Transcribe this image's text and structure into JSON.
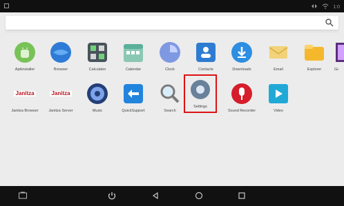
{
  "status_bar": {
    "left_icon": "notification-icon",
    "right_icons": [
      "network-icon",
      "wifi-icon"
    ],
    "clock": "1:0"
  },
  "search": {
    "placeholder": "",
    "icon": "search-icon"
  },
  "apps": [
    {
      "label": "Apkinstaller",
      "icon": "android-icon"
    },
    {
      "label": "Browser",
      "icon": "globe-icon"
    },
    {
      "label": "Calculator",
      "icon": "calculator-icon"
    },
    {
      "label": "Calendar",
      "icon": "calendar-icon"
    },
    {
      "label": "Clock",
      "icon": "clock-icon"
    },
    {
      "label": "Contacts",
      "icon": "contacts-icon"
    },
    {
      "label": "Downloads",
      "icon": "download-icon"
    },
    {
      "label": "Email",
      "icon": "email-icon"
    },
    {
      "label": "Explorer",
      "icon": "folder-icon"
    },
    {
      "label": "Gallery",
      "icon": "gallery-icon"
    },
    {
      "label": "Janitza Browser",
      "icon": "janitza-icon"
    },
    {
      "label": "Janitza Server",
      "icon": "janitza-icon"
    },
    {
      "label": "Music",
      "icon": "music-icon"
    },
    {
      "label": "QuickSupport",
      "icon": "quicksupport-icon"
    },
    {
      "label": "Search",
      "icon": "magnifier-icon"
    },
    {
      "label": "Settings",
      "icon": "gear-icon",
      "selected": true
    },
    {
      "label": "Sound Recorder",
      "icon": "microphone-icon"
    },
    {
      "label": "Video",
      "icon": "video-icon"
    }
  ],
  "janitza_text": "Janitza",
  "nav": {
    "items": [
      "screenshot-icon",
      "power-icon",
      "back-icon",
      "home-icon",
      "recents-icon"
    ]
  },
  "colors": {
    "status_bg": "#101010",
    "nav_bg": "#111111",
    "selection": "#dd1111",
    "background": "#ececec"
  }
}
